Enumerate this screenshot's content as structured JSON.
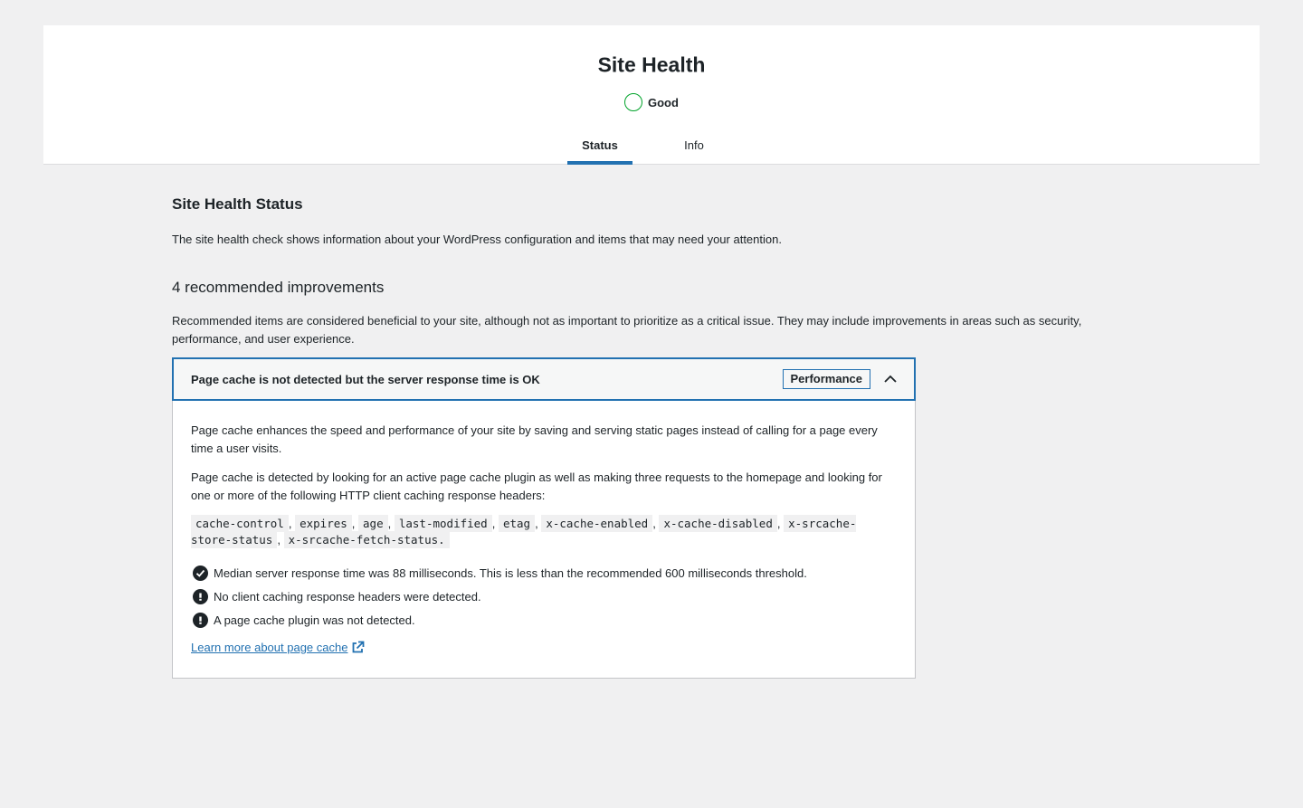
{
  "header": {
    "title": "Site Health",
    "status_label": "Good",
    "status_color": "#00a32a",
    "tabs": [
      {
        "label": "Status",
        "active": true
      },
      {
        "label": "Info",
        "active": false
      }
    ]
  },
  "main": {
    "title": "Site Health Status",
    "description": "The site health check shows information about your WordPress configuration and items that may need your attention.",
    "improvements_title": "4 recommended improvements",
    "improvements_description": "Recommended items are considered beneficial to your site, although not as important to prioritize as a critical issue. They may include improvements in areas such as security, performance, and user experience."
  },
  "item": {
    "title": "Page cache is not detected but the server response time is OK",
    "badge": "Performance",
    "accent_color": "#2271b1",
    "paragraph_1": "Page cache enhances the speed and performance of your site by saving and serving static pages instead of calling for a page every time a user visits.",
    "paragraph_2": "Page cache is detected by looking for an active page cache plugin as well as making three requests to the homepage and looking for one or more of the following HTTP client caching response headers:",
    "headers": [
      "cache-control",
      "expires",
      "age",
      "last-modified",
      "etag",
      "x-cache-enabled",
      "x-cache-disabled",
      "x-srcache-store-status",
      "x-srcache-fetch-status."
    ],
    "separator": ",",
    "results": [
      {
        "icon": "checkmark-icon",
        "text": "Median server response time was 88 milliseconds. This is less than the recommended 600 milliseconds threshold."
      },
      {
        "icon": "warning-icon",
        "text": "No client caching response headers were detected."
      },
      {
        "icon": "warning-icon",
        "text": "A page cache plugin was not detected."
      }
    ],
    "learn_more": "Learn more about page cache"
  }
}
